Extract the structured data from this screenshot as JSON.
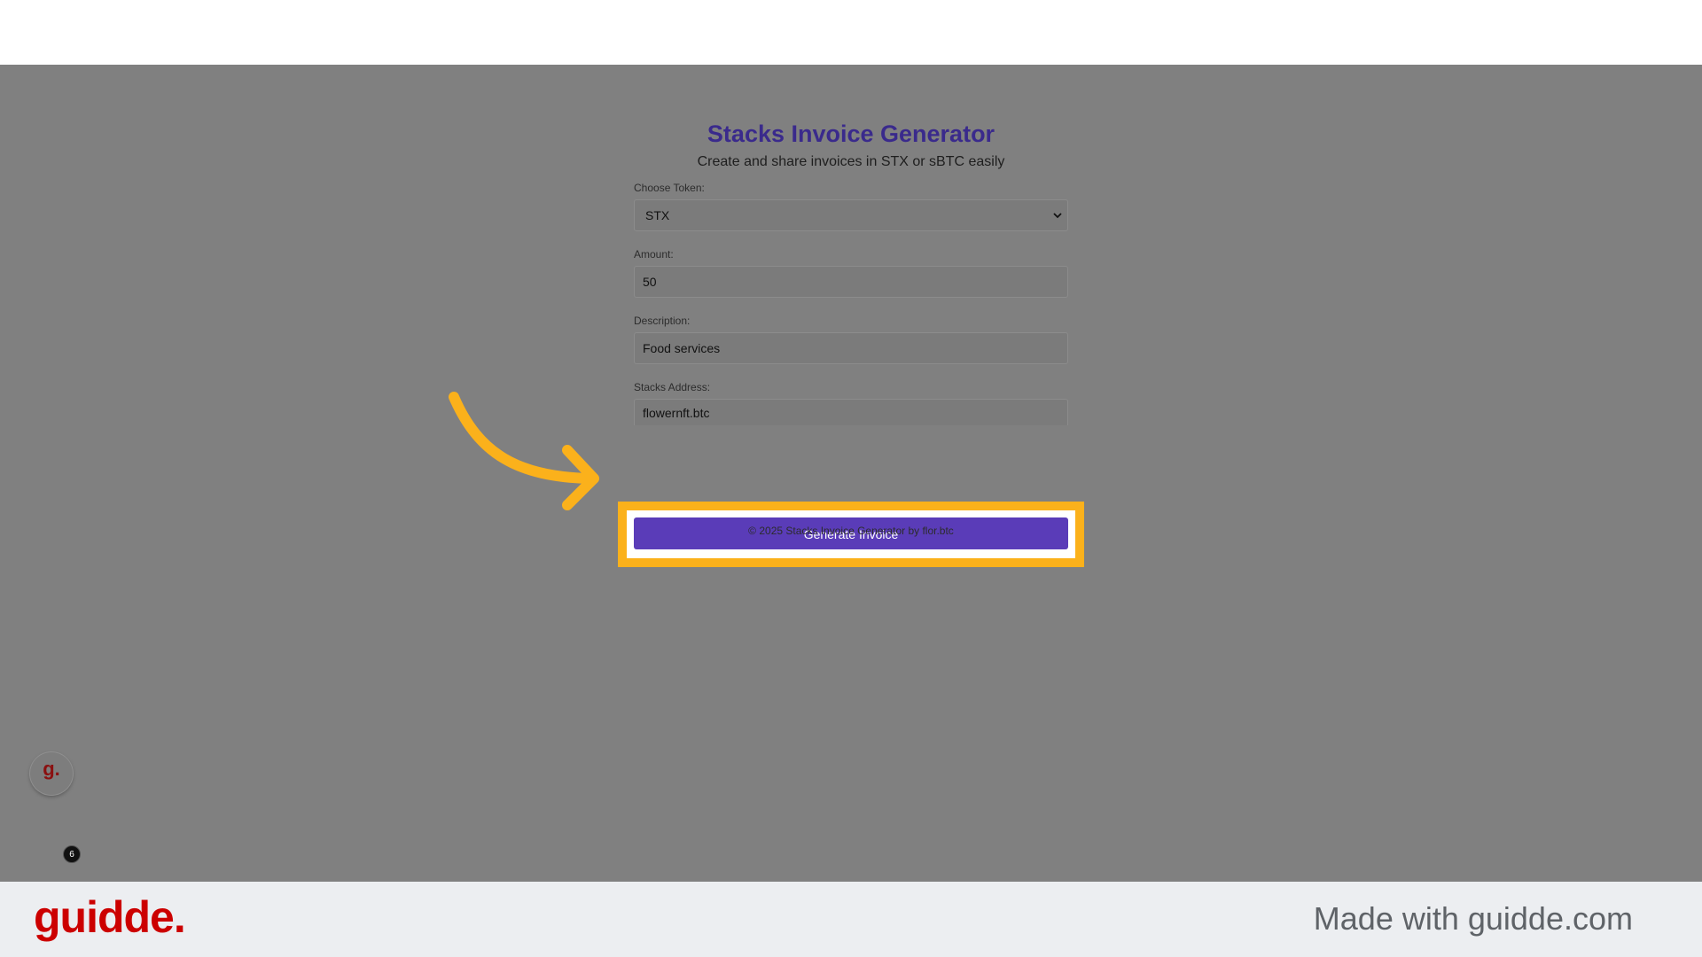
{
  "app": {
    "title": "Stacks Invoice Generator",
    "subtitle": "Create and share invoices in STX or sBTC easily",
    "token_label": "Choose Token:",
    "token_value": "STX",
    "amount_label": "Amount:",
    "amount_value": "50",
    "description_label": "Description:",
    "description_value": "Food services",
    "address_label": "Stacks Address:",
    "address_value": "flowernft.btc",
    "generate_button": "Generate Invoice",
    "footer": "© 2025 Stacks Invoice Generator by flor.btc"
  },
  "overlay": {
    "bubble_letter": "g.",
    "step_count": "6",
    "highlight_color": "#fbb11b",
    "arrow_icon": "curved-arrow-icon"
  },
  "brand": {
    "logo": "guidde.",
    "tagline": "Made with guidde.com",
    "logo_color": "#cc0000"
  }
}
